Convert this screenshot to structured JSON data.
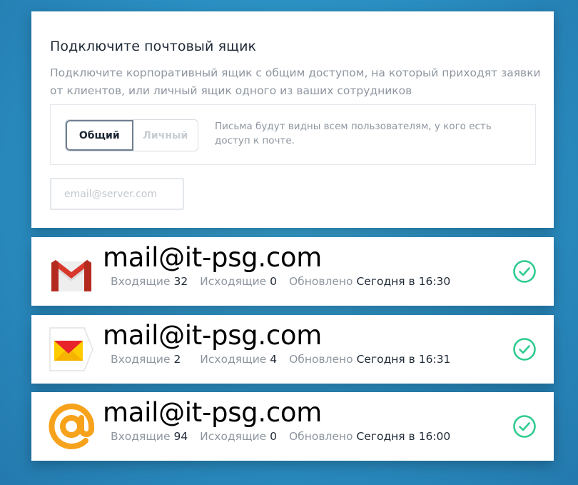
{
  "connect": {
    "title": "Подключите почтовый ящик",
    "description": "Подключите корпоративный ящик с общим доступом, на который приходят заявки от клиентов, или личный ящик одного из ваших сотрудников",
    "toggle": {
      "shared_label": "Общий",
      "personal_label": "Личный",
      "selected": "Общий"
    },
    "hint": "Письма будут видны всем пользователям, у кого есть доступ к почте.",
    "email_placeholder": "email@server.com",
    "email_value": ""
  },
  "labels": {
    "incoming": "Входящие",
    "outgoing": "Исходящие",
    "updated": "Обновлено"
  },
  "mailboxes": [
    {
      "provider_icon": "gmail-icon",
      "address": "mail@it-psg.com",
      "incoming": "32",
      "outgoing": "0",
      "updated": "Сегодня в 16:30"
    },
    {
      "provider_icon": "yandex-mail-icon",
      "address": "mail@it-psg.com",
      "incoming": "2",
      "outgoing": "4",
      "updated": "Сегодня в 16:31"
    },
    {
      "provider_icon": "mail-ru-icon",
      "address": "mail@it-psg.com",
      "incoming": "94",
      "outgoing": "0",
      "updated": "Сегодня в 16:00"
    }
  ],
  "colors": {
    "background": "#2f8fc0",
    "check": "#2ecb8f",
    "gmail_red": "#d8382c",
    "yandex_yellow": "#ffcc00",
    "yandex_red": "#e8232a",
    "mailru_orange": "#f7a21b"
  }
}
